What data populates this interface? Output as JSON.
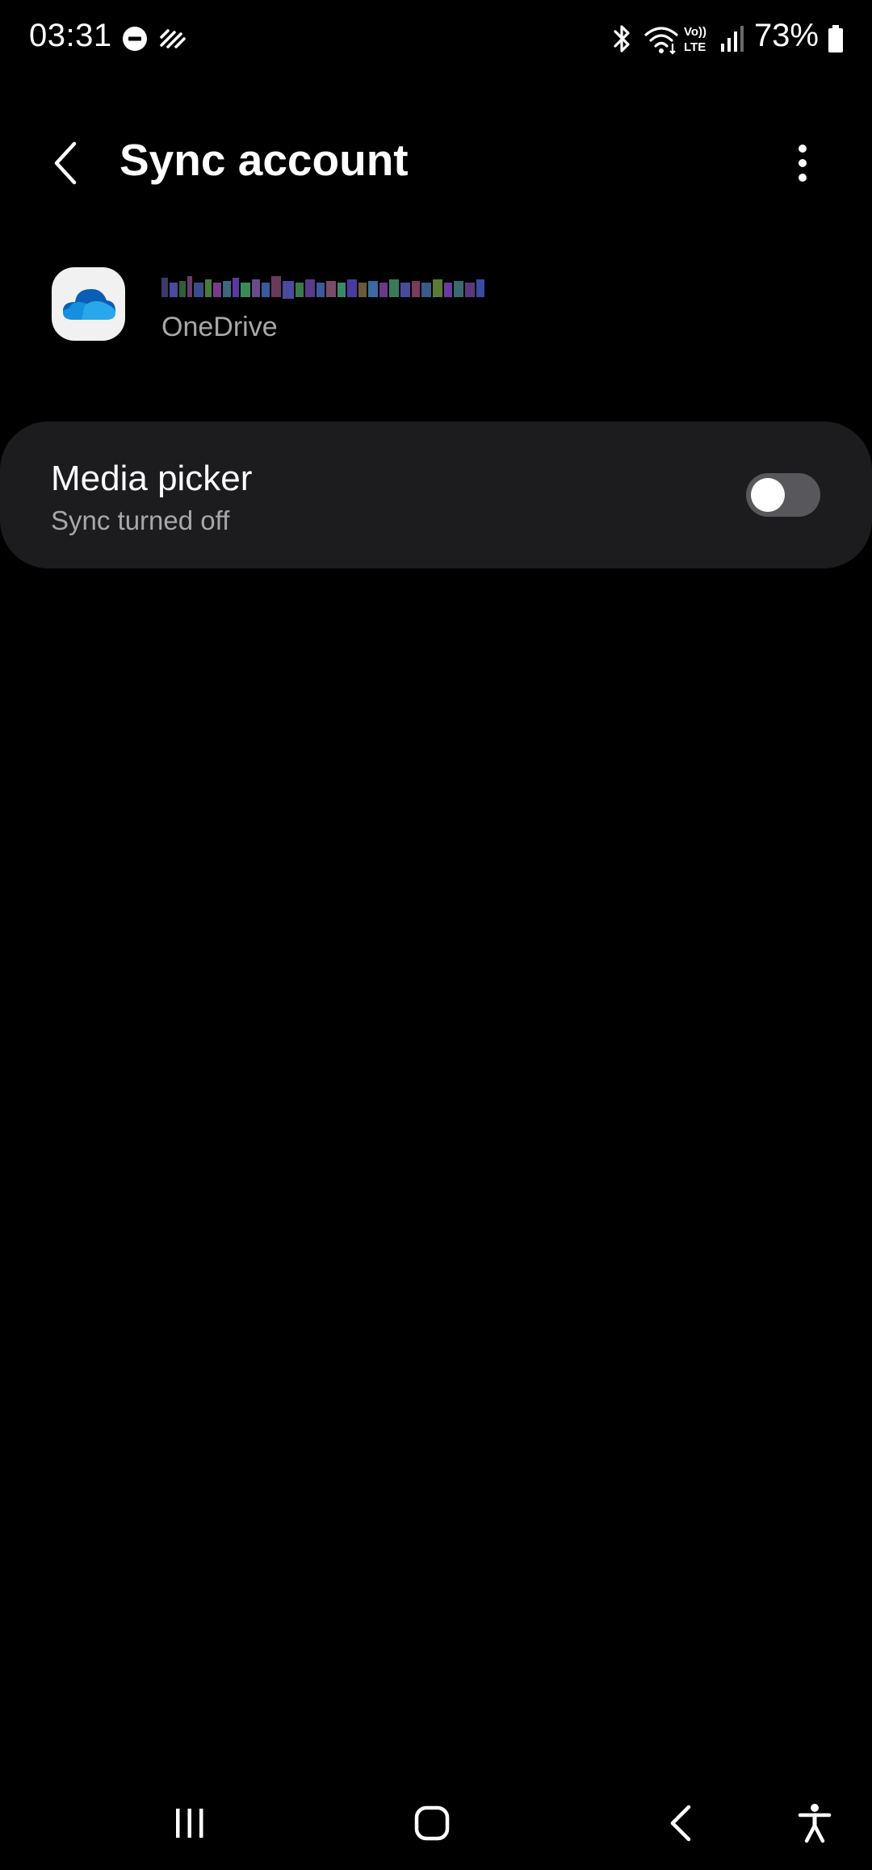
{
  "status_bar": {
    "time": "03:31",
    "battery_percent": "73%",
    "icons": [
      "do-not-disturb-icon",
      "signal-activity-icon",
      "bluetooth-icon",
      "wifi-icon",
      "volte-icon",
      "cellular-signal-icon",
      "battery-icon"
    ]
  },
  "app_bar": {
    "title": "Sync account",
    "back_icon": "back-chevron-icon",
    "more_icon": "more-vertical-icon"
  },
  "account": {
    "email": "",
    "email_redacted": true,
    "provider": "OneDrive",
    "icon": "onedrive-cloud-icon"
  },
  "sync_items": [
    {
      "title": "Media picker",
      "status": "Sync turned off",
      "enabled": false
    }
  ],
  "nav_bar": {
    "icons": [
      "recent-apps-icon",
      "home-icon",
      "back-icon",
      "accessibility-icon"
    ]
  },
  "colors": {
    "background": "#000000",
    "card": "#1c1c1e",
    "secondary_text": "#a8a8a8",
    "toggle_off_track": "#58585c",
    "onedrive_blue": "#0f78d4"
  }
}
